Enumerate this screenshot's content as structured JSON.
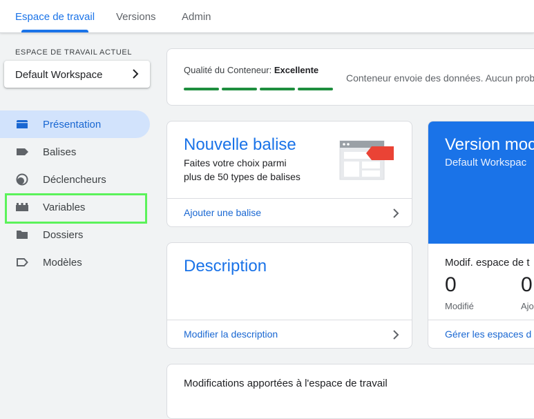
{
  "nav": {
    "tabs": [
      {
        "label": "Espace de travail",
        "active": true
      },
      {
        "label": "Versions",
        "active": false
      },
      {
        "label": "Admin",
        "active": false
      }
    ]
  },
  "sidebar": {
    "workspace_label": "ESPACE DE TRAVAIL ACTUEL",
    "workspace_name": "Default Workspace",
    "items": [
      {
        "label": "Présentation",
        "icon": "overview-icon",
        "active": true
      },
      {
        "label": "Balises",
        "icon": "tag-icon",
        "active": false
      },
      {
        "label": "Déclencheurs",
        "icon": "trigger-icon",
        "active": false
      },
      {
        "label": "Variables",
        "icon": "variables-icon",
        "active": false
      },
      {
        "label": "Dossiers",
        "icon": "folder-icon",
        "active": false
      },
      {
        "label": "Modèles",
        "icon": "template-icon",
        "active": false
      }
    ]
  },
  "quality": {
    "label": "Qualité du Conteneur:",
    "value": "Excellente",
    "description": "Conteneur envoie des données. Aucun prob"
  },
  "new_tag": {
    "title": "Nouvelle balise",
    "subtitle_line1": "Faites votre choix parmi",
    "subtitle_line2": "plus de 50 types de balises",
    "link": "Ajouter une balise"
  },
  "description": {
    "title": "Description",
    "link": "Modifier la description"
  },
  "version": {
    "title": "Version moc",
    "subtitle": "Default Workspac",
    "modif_title": "Modif. espace de t",
    "stats": [
      {
        "value": "0",
        "label": "Modifié"
      },
      {
        "value": "0",
        "label": "Ajo"
      }
    ],
    "link": "Gérer les espaces d"
  },
  "changes": {
    "title": "Modifications apportées à l'espace de travail"
  },
  "colors": {
    "accent": "#1a73e8",
    "quality_bar": "#1e8e3e",
    "highlight": "#5bf25a",
    "tag_red": "#ea4335"
  }
}
